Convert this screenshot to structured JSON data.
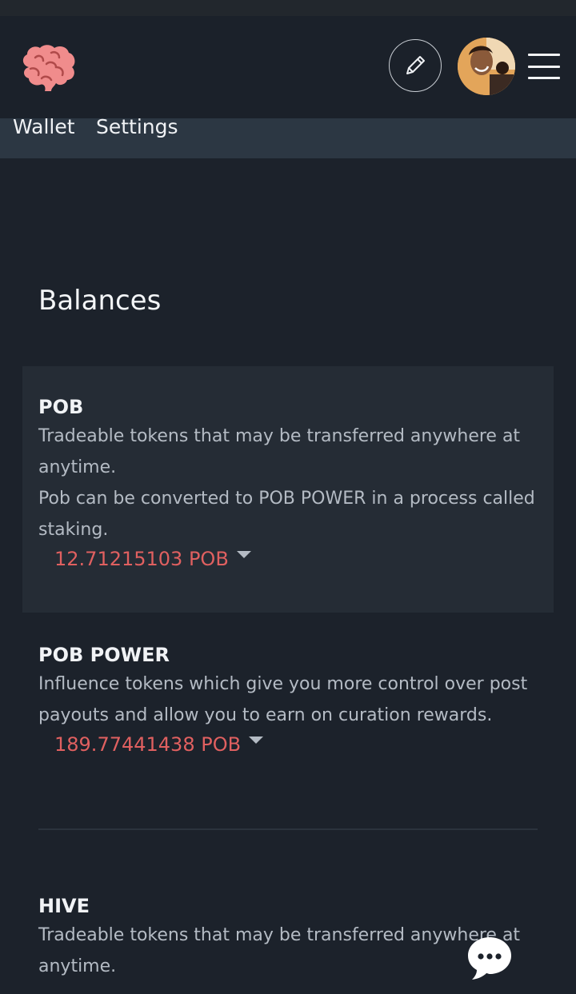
{
  "header": {
    "logo_icon": "brain-logo-icon",
    "edit_icon": "pencil-icon",
    "avatar_icon": "user-avatar",
    "menu_icon": "hamburger-menu-icon"
  },
  "nav": {
    "items": [
      {
        "label": "Wallet"
      },
      {
        "label": "Settings"
      }
    ]
  },
  "main": {
    "title": "Balances",
    "balances": [
      {
        "name": "POB",
        "description_lines": [
          "Tradeable tokens that may be transferred anywhere at anytime.",
          "Pob can be converted to POB POWER in a process called staking."
        ],
        "amount": "12.71215103 POB"
      },
      {
        "name": "POB POWER",
        "description_lines": [
          "Influence tokens which give you more control over post payouts and allow you to earn on curation rewards."
        ],
        "amount": "189.77441438 POB"
      },
      {
        "name": "HIVE",
        "description_lines": [
          "Tradeable tokens that may be transferred anywhere at anytime."
        ]
      }
    ]
  },
  "chat": {
    "icon": "chat-bubble-icon"
  },
  "colors": {
    "background": "#1c222b",
    "header": "#1b212a",
    "subnav": "#2c3743",
    "card": "#252c35",
    "amount": "#e06060",
    "logo": "#f08c8c"
  }
}
